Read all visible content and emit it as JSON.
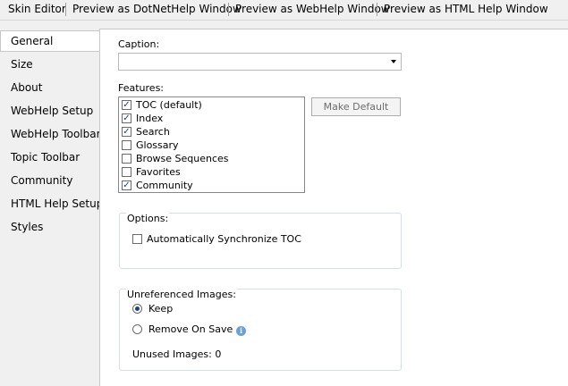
{
  "top_tabs": [
    {
      "label": "Skin Editor"
    },
    {
      "label": "Preview as DotNetHelp Window"
    },
    {
      "label": "Preview as WebHelp Window"
    },
    {
      "label": "Preview as HTML Help Window"
    }
  ],
  "sidebar": {
    "items": [
      {
        "label": "General"
      },
      {
        "label": "Size"
      },
      {
        "label": "About"
      },
      {
        "label": "WebHelp Setup"
      },
      {
        "label": "WebHelp Toolbar"
      },
      {
        "label": "Topic Toolbar"
      },
      {
        "label": "Community"
      },
      {
        "label": "HTML Help Setup"
      },
      {
        "label": "Styles"
      }
    ],
    "selected": "General"
  },
  "general": {
    "caption_label": "Caption:",
    "caption_value": "",
    "features_label": "Features:",
    "features": [
      {
        "label": "TOC (default)",
        "checked": "✓"
      },
      {
        "label": "Index",
        "checked": "✓"
      },
      {
        "label": "Search",
        "checked": "✓"
      },
      {
        "label": "Glossary",
        "checked": ""
      },
      {
        "label": "Browse Sequences",
        "checked": ""
      },
      {
        "label": "Favorites",
        "checked": ""
      },
      {
        "label": "Community",
        "checked": "✓"
      }
    ],
    "make_default_label": "Make Default",
    "options": {
      "title": "Options:",
      "auto_sync_label": "Automatically Synchronize TOC"
    },
    "unreferenced": {
      "title": "Unreferenced Images:",
      "keep_label": "Keep",
      "remove_label": "Remove On Save",
      "unused_label": "Unused Images: 0"
    }
  }
}
